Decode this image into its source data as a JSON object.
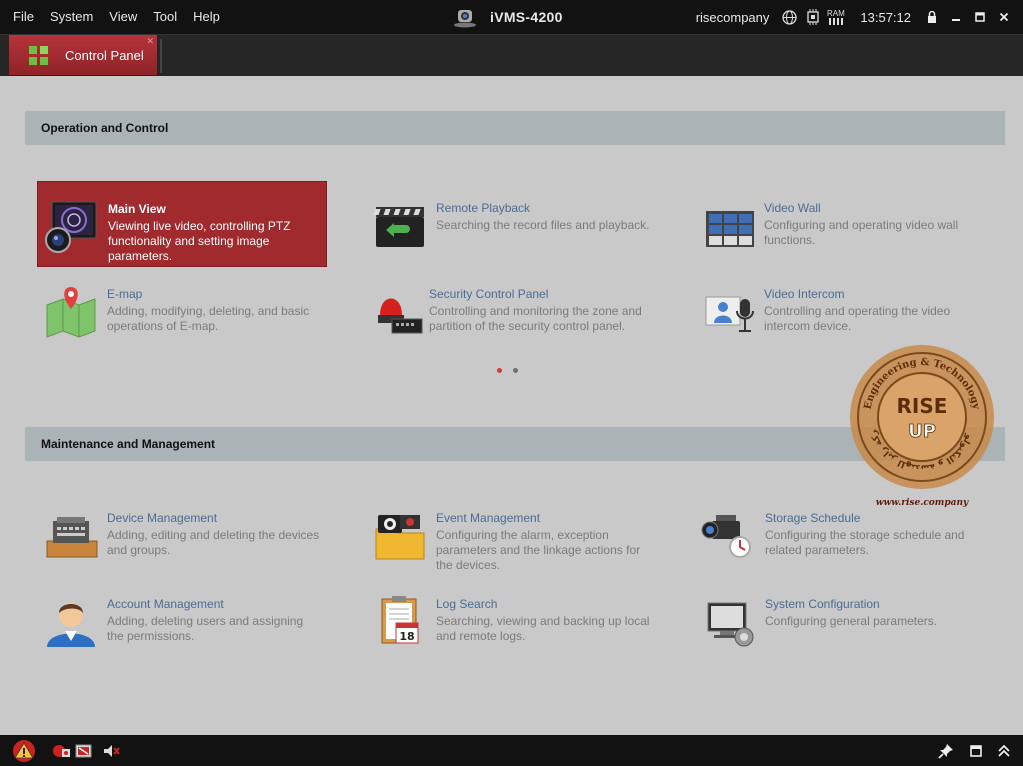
{
  "menu": {
    "items": [
      "File",
      "System",
      "View",
      "Tool",
      "Help"
    ]
  },
  "app": {
    "title": "iVMS-4200",
    "user": "risecompany",
    "time": "13:57:12",
    "ram_label": "RAM"
  },
  "tab": {
    "label": "Control Panel"
  },
  "sections": {
    "operation": {
      "title": "Operation and Control",
      "items": [
        {
          "name": "Main View",
          "desc": "Viewing live video, controlling PTZ functionality and setting image parameters."
        },
        {
          "name": "Remote Playback",
          "desc": "Searching the record files and playback."
        },
        {
          "name": "Video Wall",
          "desc": "Configuring and operating video wall functions."
        },
        {
          "name": "E-map",
          "desc": "Adding, modifying, deleting, and basic operations of E-map."
        },
        {
          "name": "Security Control Panel",
          "desc": "Controlling and monitoring the zone and partition of the security control panel."
        },
        {
          "name": "Video Intercom",
          "desc": "Controlling and operating the video intercom device."
        }
      ]
    },
    "maintenance": {
      "title": "Maintenance and Management",
      "items": [
        {
          "name": "Device Management",
          "desc": "Adding, editing and deleting the devices and groups."
        },
        {
          "name": "Event Management",
          "desc": "Configuring the alarm, exception parameters and the linkage actions for the devices."
        },
        {
          "name": "Storage Schedule",
          "desc": "Configuring the storage schedule and related parameters."
        },
        {
          "name": "Account Management",
          "desc": "Adding, deleting users and assigning the permissions."
        },
        {
          "name": "Log Search",
          "desc": "Searching, viewing and backing up local and remote logs."
        },
        {
          "name": "System Configuration",
          "desc": "Configuring general parameters."
        }
      ]
    }
  },
  "pager": {
    "page_count": 2,
    "current_page": 1
  },
  "watermark": {
    "top_text": "Engineering & Technology",
    "logo_line1": "RISE",
    "logo_line2": "UP",
    "arabic_text": "شركة رايز للهندسة و التكنولوجيا",
    "url": "www.rise.company"
  },
  "colors": {
    "accent": "#a12a2f",
    "link": "#4a6c93",
    "header_bg": "#aab3b6",
    "active_dot": "#d43b3b",
    "inactive_dot": "#6e6e6e"
  },
  "icons": {
    "bottom": [
      "alarm-warning-icon",
      "alarm-event-icon",
      "video-loss-icon",
      "mute-icon"
    ],
    "bottom_right": [
      "pin-icon",
      "maximize-icon",
      "collapse-icon"
    ]
  }
}
